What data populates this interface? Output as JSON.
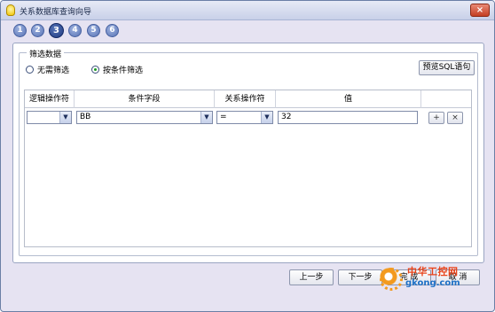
{
  "window": {
    "title": "关系数据库查询向导",
    "close_label": "×"
  },
  "steps": [
    "1",
    "2",
    "3",
    "4",
    "5",
    "6"
  ],
  "active_step": "3",
  "filter": {
    "group_title": "筛选数据",
    "option_none": "无需筛选",
    "option_condition": "按条件筛选",
    "selected_option": "按条件筛选",
    "preview_button": "预览SQL语句"
  },
  "table": {
    "headers": [
      "逻辑操作符",
      "条件字段",
      "关系操作符",
      "值"
    ],
    "rows": [
      {
        "logic_op": "",
        "field": "BB",
        "relation_op": "=",
        "value": "32"
      }
    ],
    "add_label": "+",
    "remove_label": "×"
  },
  "footer": {
    "prev": "上一步",
    "next": "下一步",
    "finish": "完 成",
    "cancel": "取 消"
  },
  "watermark": {
    "cn": "中华工控网",
    "en": "gkong.com"
  },
  "colors": {
    "window_bg": "#e6e3f2",
    "radio_dot": "#1a9a20",
    "step_active": "#1f3a7f",
    "step_inactive": "#5873b5",
    "close_btn": "#c43f23"
  },
  "icons": [
    "app-bulb-icon",
    "close-icon",
    "dropdown-arrow-icon",
    "gear-logo-icon"
  ]
}
